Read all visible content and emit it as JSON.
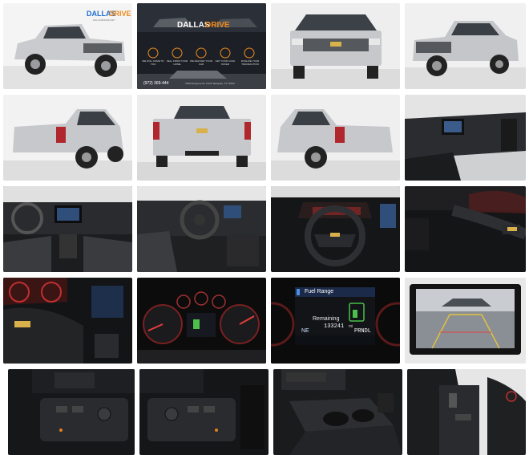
{
  "brand": {
    "logo_word1": "DALLAS",
    "logo_word2": "DRIVE",
    "logo_sub": "DALLASDRIVE.NET",
    "primary_color": "#1f6fd1",
    "accent_color": "#f08a1c"
  },
  "promo": {
    "features": [
      "WE WILL COME TO YOU",
      "SELL FROM YOUR HOME",
      "WE DELIVER YOUR CAR",
      "GET YOUR CASH OFFER",
      "FINALIZE YOUR TRANSACTION"
    ],
    "phone": "(972) 369-444",
    "address": "7625 Rungrone Dr. FXXX Mesquite, TX 75150"
  },
  "cluster": {
    "fuel_range_label": "Fuel Range",
    "remaining_label": "Remaining",
    "odometer": "133241",
    "odometer_unit": "mi",
    "heading": "NE",
    "gear": "PRNDL"
  },
  "tile_labels": [
    "exterior-front-left-logo",
    "dealer-promo-banner",
    "exterior-front",
    "exterior-front-right",
    "exterior-rear-left",
    "exterior-rear",
    "exterior-rear-right",
    "interior-dash-door",
    "interior-dashboard-wide",
    "interior-driver-view",
    "steering-wheel",
    "steering-wheel-closeup",
    "steering-wheel-right-controls",
    "instrument-cluster",
    "cluster-fuel-range",
    "backup-camera-screen",
    "hvac-controls-left",
    "hvac-controls-right",
    "center-console-cupholders",
    "shifter-column"
  ]
}
